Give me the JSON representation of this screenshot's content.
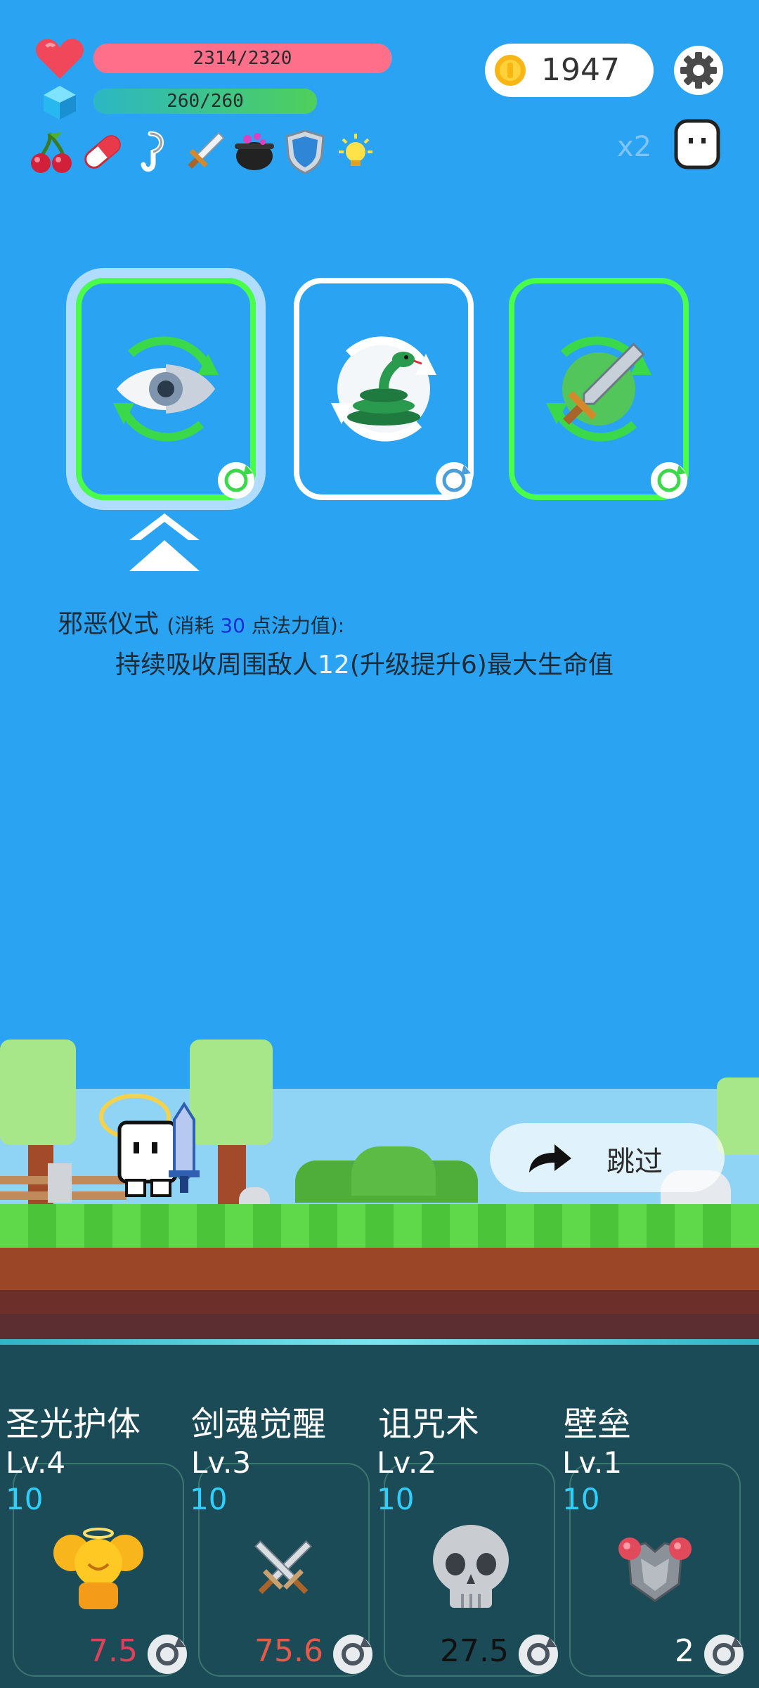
{
  "hud": {
    "hp_text": "2314/2320",
    "hp_ratio": 0.997,
    "mp_text": "260/260",
    "mp_ratio": 1.0,
    "coins": "1947",
    "speed_label": "x2"
  },
  "inventory": [
    "cherries-icon",
    "pill-icon",
    "hook-icon",
    "sword-icon",
    "cauldron-icon",
    "shield-icon",
    "lightbulb-icon"
  ],
  "skill_choice": {
    "name": "邪恶仪式",
    "cost_prefix": "(消耗",
    "cost_value": "30",
    "cost_suffix": "点法力值):",
    "desc_prefix": "持续吸收周围敌人",
    "desc_value": "12",
    "desc_suffix": "(升级提升6)最大生命值"
  },
  "cards": [
    {
      "icon": "eye-icon",
      "selected": true
    },
    {
      "icon": "snake-icon",
      "selected": false
    },
    {
      "icon": "sword-icon",
      "selected": false
    }
  ],
  "skip_label": "跳过",
  "skills": [
    {
      "name": "圣光护体",
      "level": "Lv.4",
      "cost": "10",
      "value": "7.5",
      "value_color": "#e0405a",
      "icon": "angel-icon"
    },
    {
      "name": "剑魂觉醒",
      "level": "Lv.3",
      "cost": "10",
      "value": "75.6",
      "value_color": "#e65a4a",
      "icon": "crossed-swords-icon"
    },
    {
      "name": "诅咒术",
      "level": "Lv.2",
      "cost": "10",
      "value": "27.5",
      "value_color": "#111111",
      "icon": "skull-icon"
    },
    {
      "name": "壁垒",
      "level": "Lv.1",
      "cost": "10",
      "value": "2",
      "value_color": "#ffffff",
      "icon": "armor-icon"
    }
  ],
  "colors": {
    "sky": "#2aa3f2",
    "hp_bar": "#ff6f8a",
    "mp_bar": "#3ccf6a",
    "card_border_green": "#49ff49",
    "skill_panel": "#1b4b57"
  }
}
